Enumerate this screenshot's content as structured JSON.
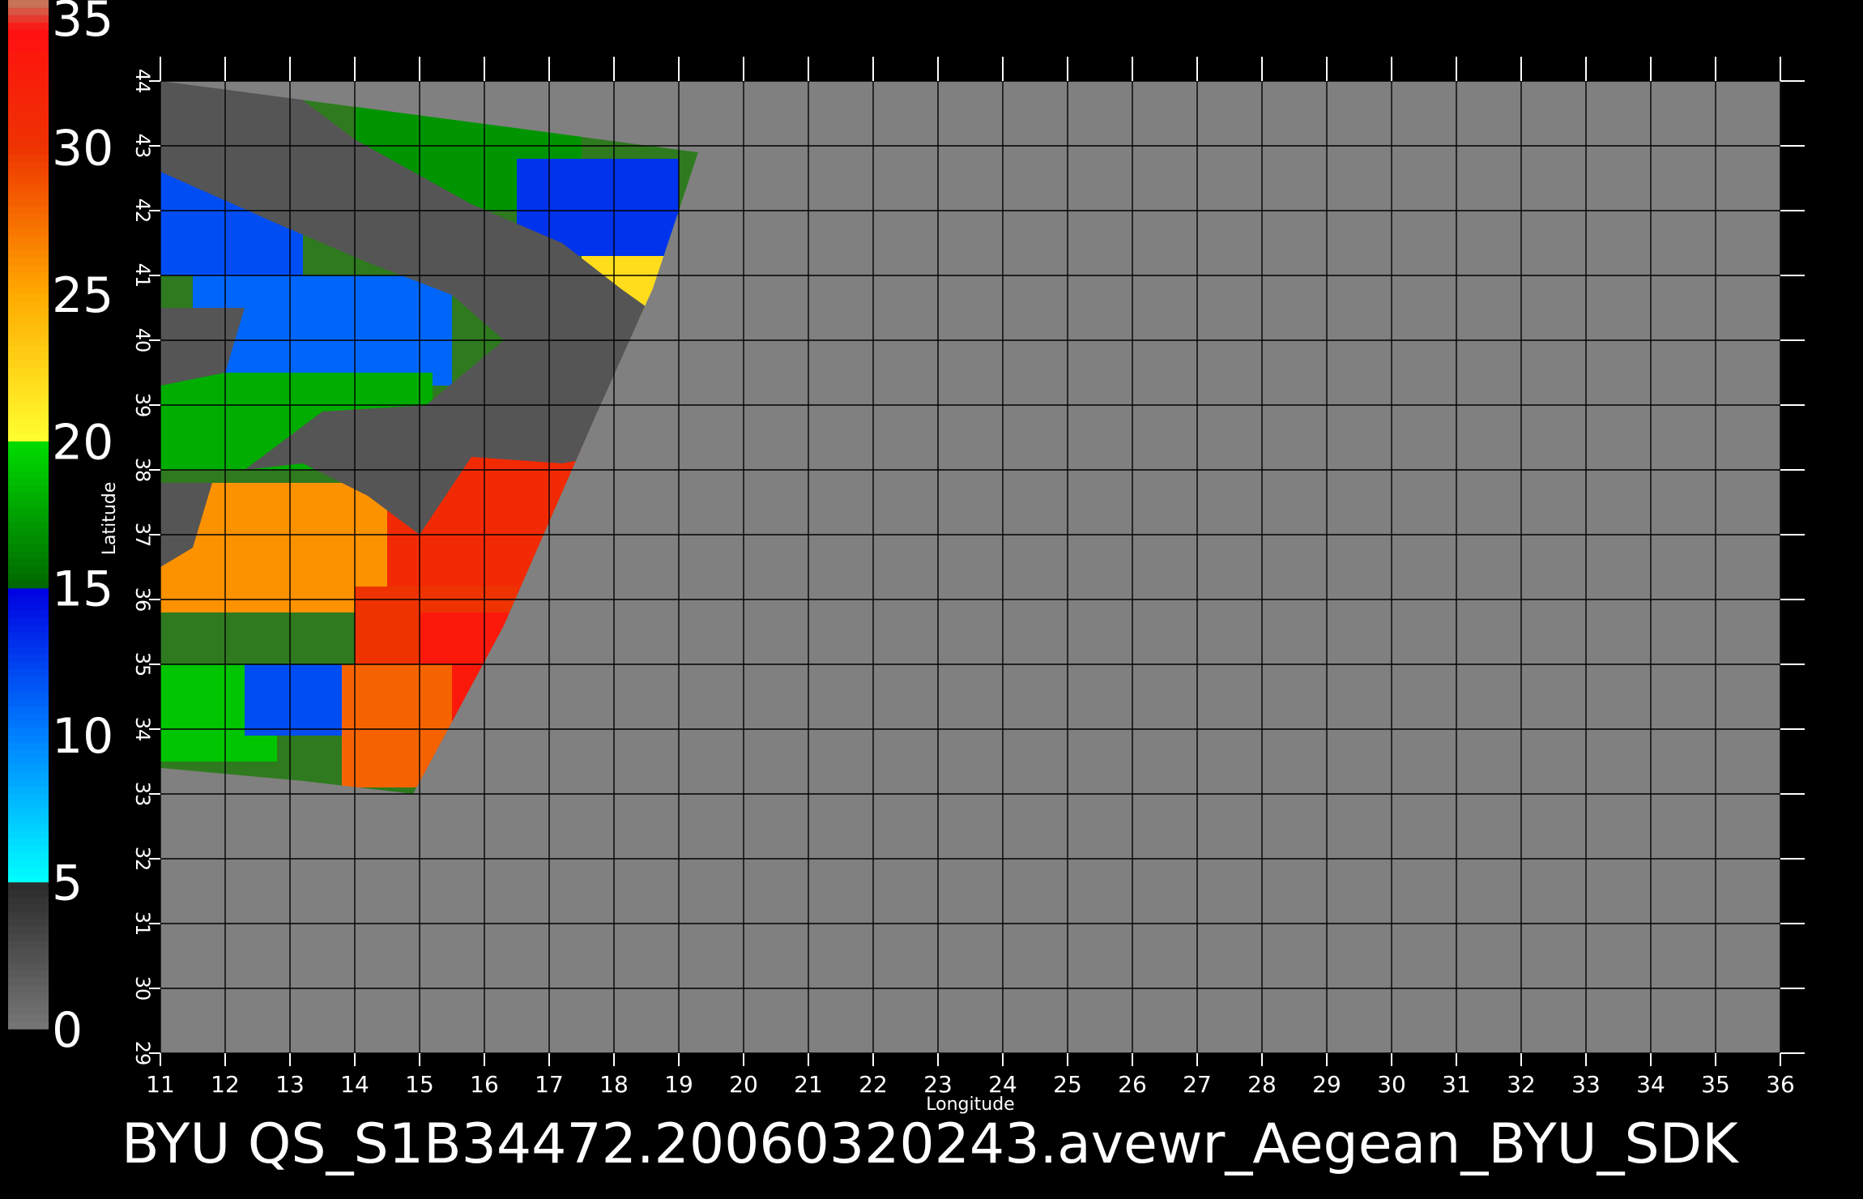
{
  "chart_data": {
    "type": "heatmap",
    "title": "BYU  QS_S1B34472.20060320243.avewr_Aegean_BYU_SDK",
    "xlabel": "Longitude",
    "ylabel": "Latitude",
    "xlim": [
      11,
      36
    ],
    "ylim": [
      29,
      44
    ],
    "grid": true,
    "x_ticks": [
      "11",
      "12",
      "13",
      "14",
      "15",
      "16",
      "17",
      "18",
      "19",
      "20",
      "21",
      "22",
      "23",
      "24",
      "25",
      "26",
      "27",
      "28",
      "29",
      "30",
      "31",
      "32",
      "33",
      "34",
      "35",
      "36"
    ],
    "y_ticks": [
      "29",
      "30",
      "31",
      "32",
      "33",
      "34",
      "35",
      "36",
      "37",
      "38",
      "39",
      "40",
      "41",
      "42",
      "43",
      "44"
    ],
    "colorbar": {
      "min": 0,
      "max": 35,
      "tick_labels": [
        "35",
        "30",
        "25",
        "20",
        "15",
        "10",
        "5",
        "0"
      ],
      "stops": [
        {
          "value": 0,
          "color": "#777777"
        },
        {
          "value": 5,
          "color": "#2a2a2a"
        },
        {
          "value": 5.01,
          "color": "#00ffff"
        },
        {
          "value": 10,
          "color": "#0080ff"
        },
        {
          "value": 15,
          "color": "#0000e0"
        },
        {
          "value": 15.01,
          "color": "#006600"
        },
        {
          "value": 20,
          "color": "#00dd00"
        },
        {
          "value": 20.01,
          "color": "#ffff30"
        },
        {
          "value": 25,
          "color": "#ffaa00"
        },
        {
          "value": 30,
          "color": "#ee3300"
        },
        {
          "value": 34,
          "color": "#ff1010"
        },
        {
          "value": 35,
          "color": "#c08060"
        }
      ]
    },
    "colors": {
      "background": "#000000",
      "no_data": "#808080",
      "land": "#555555",
      "grid": "#000000"
    },
    "swath_polygon": [
      [
        11,
        44
      ],
      [
        19.3,
        42.9
      ],
      [
        18.6,
        40.8
      ],
      [
        17.7,
        38.8
      ],
      [
        16.3,
        35.6
      ],
      [
        14.9,
        33.0
      ],
      [
        13.2,
        33.2
      ],
      [
        11,
        33.4
      ]
    ],
    "land_polygons": [
      [
        [
          12.8,
          44
        ],
        [
          14.0,
          43.1
        ],
        [
          15.8,
          42.1
        ],
        [
          17.2,
          41.5
        ],
        [
          18.1,
          40.8
        ],
        [
          18.8,
          40.3
        ],
        [
          19.1,
          39.2
        ],
        [
          18.3,
          38.3
        ],
        [
          17.2,
          38.1
        ],
        [
          15.8,
          38.2
        ],
        [
          15.0,
          37.0
        ],
        [
          14.2,
          37.6
        ],
        [
          13.2,
          38.1
        ],
        [
          12.3,
          38.0
        ],
        [
          13.5,
          38.9
        ],
        [
          15.1,
          39.0
        ],
        [
          16.3,
          40.0
        ],
        [
          15.5,
          40.7
        ],
        [
          14.2,
          41.2
        ],
        [
          12.8,
          41.8
        ],
        [
          11.0,
          42.6
        ],
        [
          11.0,
          44
        ]
      ],
      [
        [
          11.0,
          40.5
        ],
        [
          12.3,
          40.5
        ],
        [
          12.0,
          39.5
        ],
        [
          11.0,
          39.3
        ]
      ],
      [
        [
          11.0,
          37.8
        ],
        [
          11.8,
          37.8
        ],
        [
          11.5,
          36.8
        ],
        [
          11.0,
          36.5
        ]
      ]
    ],
    "wind_zones": [
      {
        "lon": [
          11.0,
          13.2
        ],
        "lat": [
          41.0,
          42.6
        ],
        "speed": 12
      },
      {
        "lon": [
          11.5,
          15.5
        ],
        "lat": [
          39.3,
          41.0
        ],
        "speed": 11
      },
      {
        "lon": [
          11.0,
          15.2
        ],
        "lat": [
          38.0,
          39.5
        ],
        "speed": 18
      },
      {
        "lon": [
          14.0,
          17.5
        ],
        "lat": [
          42.0,
          44.0
        ],
        "speed": 17
      },
      {
        "lon": [
          16.5,
          19.0
        ],
        "lat": [
          41.3,
          42.8
        ],
        "speed": 13
      },
      {
        "lon": [
          17.5,
          19.0
        ],
        "lat": [
          40.3,
          41.3
        ],
        "speed": 22
      },
      {
        "lon": [
          11.0,
          14.5
        ],
        "lat": [
          35.8,
          37.8
        ],
        "speed": 26
      },
      {
        "lon": [
          14.5,
          17.8
        ],
        "lat": [
          36.0,
          38.5
        ],
        "speed": 31
      },
      {
        "lon": [
          14.0,
          16.5
        ],
        "lat": [
          34.0,
          36.2
        ],
        "speed": 30
      },
      {
        "lon": [
          15.0,
          16.8
        ],
        "lat": [
          33.3,
          35.8
        ],
        "speed": 33
      },
      {
        "lon": [
          11.0,
          12.8
        ],
        "lat": [
          33.5,
          35.0
        ],
        "speed": 19
      },
      {
        "lon": [
          12.3,
          13.8
        ],
        "lat": [
          33.9,
          35.0
        ],
        "speed": 12
      },
      {
        "lon": [
          13.8,
          15.5
        ],
        "lat": [
          33.1,
          35.0
        ],
        "speed": 28
      }
    ]
  }
}
